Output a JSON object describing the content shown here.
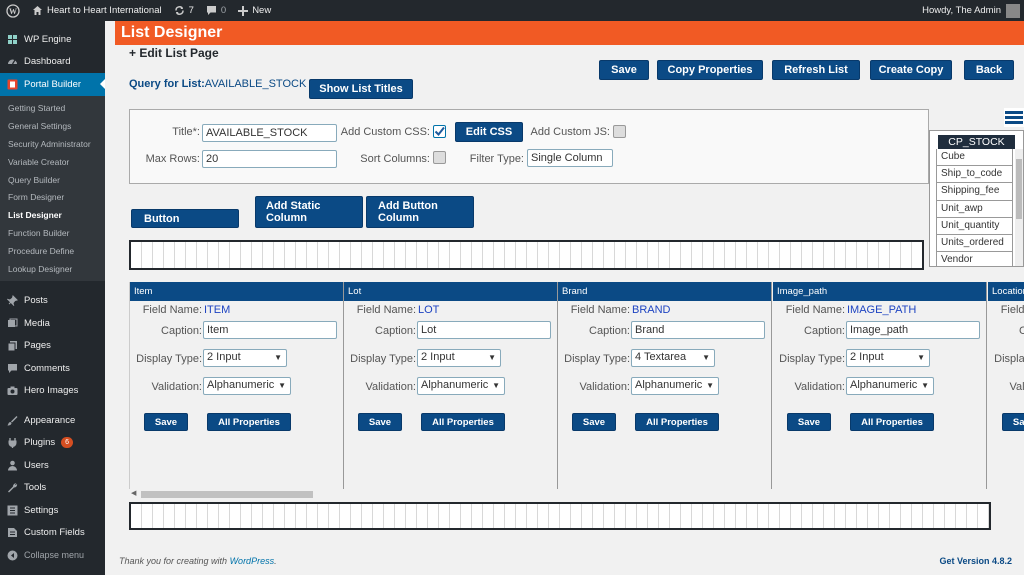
{
  "adminbar": {
    "site_name": "Heart to Heart International",
    "updates_count": "7",
    "comments_count": "0",
    "new_label": "New",
    "greeting": "Howdy, The Admin"
  },
  "sidebar": {
    "top_items": [
      {
        "label": "WP Engine",
        "icon": "wp-engine-icon"
      },
      {
        "label": "Dashboard",
        "icon": "dashboard-icon"
      },
      {
        "label": "Portal Builder",
        "icon": "portal-builder-icon"
      }
    ],
    "submenu": [
      "Getting Started",
      "General Settings",
      "Security Administrator",
      "Variable Creator",
      "Query Builder",
      "Form Designer",
      "List Designer",
      "Function Builder",
      "Procedure Define",
      "Lookup Designer"
    ],
    "active_submenu": "List Designer",
    "items": [
      {
        "label": "Posts",
        "icon": "pin-icon"
      },
      {
        "label": "Media",
        "icon": "media-icon"
      },
      {
        "label": "Pages",
        "icon": "pages-icon"
      },
      {
        "label": "Comments",
        "icon": "comments-icon"
      },
      {
        "label": "Hero Images",
        "icon": "camera-icon"
      },
      {
        "label": "Appearance",
        "icon": "brush-icon"
      },
      {
        "label": "Plugins",
        "icon": "plugin-icon",
        "badge": "6"
      },
      {
        "label": "Users",
        "icon": "users-icon"
      },
      {
        "label": "Tools",
        "icon": "wrench-icon"
      },
      {
        "label": "Settings",
        "icon": "settings-icon"
      },
      {
        "label": "Custom Fields",
        "icon": "custom-fields-icon"
      },
      {
        "label": "Collapse menu",
        "icon": "collapse-icon"
      }
    ]
  },
  "page": {
    "title": "List Designer",
    "subtitle": "+ Edit List Page",
    "query_prefix": "Query for List:",
    "query_name": "AVAILABLE_STOCK",
    "show_titles_label": "Show List Titles"
  },
  "toolbar": {
    "save": "Save",
    "copy_properties": "Copy Properties",
    "refresh_list": "Refresh List",
    "create_copy": "Create Copy",
    "back": "Back"
  },
  "settings": {
    "title_label": "Title*:",
    "title_value": "AVAILABLE_STOCK",
    "custom_css_label": "Add Custom CSS:",
    "custom_css_checked": true,
    "edit_css_label": "Edit CSS",
    "custom_js_label": "Add Custom JS:",
    "max_rows_label": "Max Rows:",
    "max_rows_value": "20",
    "sort_columns_label": "Sort Columns:",
    "filter_type_label": "Filter Type:",
    "filter_type_value": "Single Column"
  },
  "add_buttons": {
    "button": "Button",
    "add_static_column": "Add Static Column",
    "add_button_column": "Add Button Column"
  },
  "field_list": {
    "header": "CP_STOCK",
    "items": [
      "Cube",
      "Ship_to_code",
      "Shipping_fee",
      "Unit_awp",
      "Unit_quantity",
      "Units_ordered",
      "Vendor"
    ]
  },
  "column_labels": {
    "field_name": "Field Name:",
    "caption": "Caption:",
    "display_type": "Display Type:",
    "validation": "Validation:",
    "save": "Save",
    "all_properties": "All Properties"
  },
  "columns": [
    {
      "header": "Item",
      "field_name": "ITEM",
      "caption": "Item",
      "display_type": "2 Input",
      "validation": "Alphanumeric"
    },
    {
      "header": "Lot",
      "field_name": "LOT",
      "caption": "Lot",
      "display_type": "2 Input",
      "validation": "Alphanumeric"
    },
    {
      "header": "Brand",
      "field_name": "BRAND",
      "caption": "Brand",
      "display_type": "4 Textarea",
      "validation": "Alphanumeric"
    },
    {
      "header": "Image_path",
      "field_name": "IMAGE_PATH",
      "caption": "Image_path",
      "display_type": "2 Input",
      "validation": "Alphanumeric"
    },
    {
      "header": "Location",
      "field_name": "",
      "caption": "",
      "display_type": "",
      "validation": ""
    }
  ],
  "footer": {
    "thanks_prefix": "Thank you for creating with ",
    "wordpress": "WordPress",
    "thanks_suffix": ".",
    "version": "Get Version 4.8.2"
  }
}
